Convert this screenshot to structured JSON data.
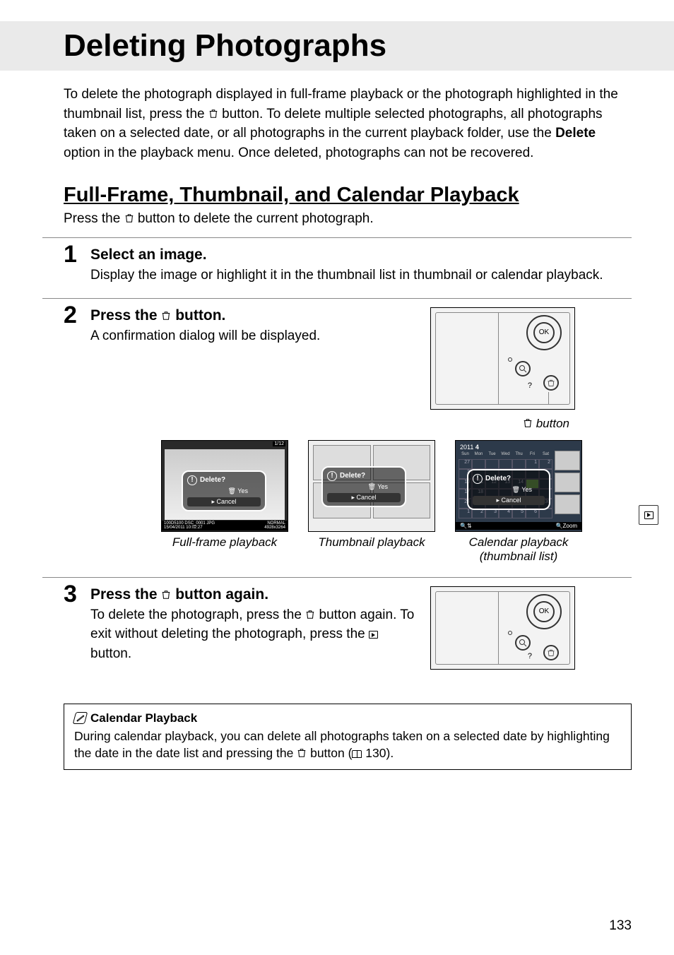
{
  "page_number": "133",
  "main_title": "Deleting Photographs",
  "intro": {
    "part1": "To delete the photograph displayed in full-frame playback or the photograph highlighted in the thumbnail list, press the ",
    "part2": " button.  To delete multiple selected photographs, all photographs taken on a selected date, or all photographs in the current playback folder, use the ",
    "bold": "Delete",
    "part3": " option in the playback menu.  Once deleted, photographs can not be recovered."
  },
  "section_title": "Full-Frame, Thumbnail, and Calendar Playback",
  "section_sub_a": "Press the ",
  "section_sub_b": " button to delete the current photograph.",
  "steps": {
    "s1": {
      "num": "1",
      "title": "Select an image.",
      "desc": "Display the image or highlight it in the thumbnail list in thumbnail or calendar playback."
    },
    "s2": {
      "num": "2",
      "title_a": "Press the ",
      "title_b": " button.",
      "desc": "A confirmation dialog will be displayed.",
      "button_caption": " button",
      "captions": {
        "full": "Full-frame playback",
        "thumb": "Thumbnail playback",
        "cal_a": "Calendar playback",
        "cal_b": "(thumbnail list)"
      },
      "dialog": {
        "question": "Delete?",
        "yes": "Yes",
        "cancel": "Cancel"
      },
      "full_footer": {
        "left": "100D5100  DSC_0001  JPG",
        "date": "15/04/2011 10:02:27",
        "right": "NORMAL",
        "dims": "4928x3264",
        "count": "1/12"
      },
      "calendar": {
        "year": "2011",
        "month": "4",
        "days": [
          "Sun",
          "Mon",
          "Tue",
          "Wed",
          "Thu",
          "Fri",
          "Sat"
        ],
        "zoom": "Zoom",
        "yes": "Yes",
        "cancel": "Cancel"
      }
    },
    "s3": {
      "num": "3",
      "title_a": "Press the ",
      "title_b": " button again.",
      "desc_a": "To delete the photograph, press the ",
      "desc_b": " button again.  To exit without deleting the photograph, press the ",
      "desc_c": " button."
    }
  },
  "note": {
    "title": "Calendar Playback",
    "text_a": "During calendar playback, you can delete all photographs taken on a selected date by highlighting the date in the date list and pressing the ",
    "text_b": " button (",
    "page_ref": " 130).",
    "ok": "OK"
  }
}
